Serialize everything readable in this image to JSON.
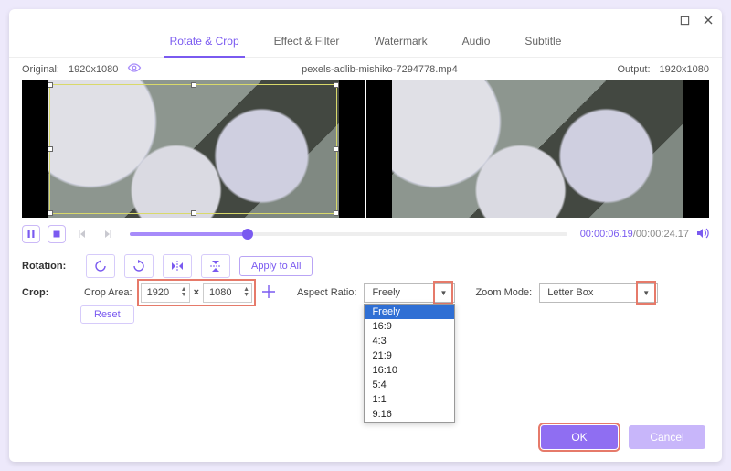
{
  "tabs": {
    "rotate_crop": "Rotate & Crop",
    "effect_filter": "Effect & Filter",
    "watermark": "Watermark",
    "audio": "Audio",
    "subtitle": "Subtitle"
  },
  "infobar": {
    "original_label": "Original:",
    "original_res": "1920x1080",
    "filename": "pexels-adlib-mishiko-7294778.mp4",
    "output_label": "Output:",
    "output_res": "1920x1080"
  },
  "playback": {
    "current": "00:00:06.19",
    "duration": "00:00:24.17"
  },
  "rotation": {
    "label": "Rotation:",
    "apply_all": "Apply to All"
  },
  "crop": {
    "label": "Crop:",
    "area_label": "Crop Area:",
    "width": "1920",
    "height": "1080",
    "reset": "Reset",
    "aspect_label": "Aspect Ratio:",
    "aspect_value": "Freely",
    "aspect_options": [
      "Freely",
      "16:9",
      "4:3",
      "21:9",
      "16:10",
      "5:4",
      "1:1",
      "9:16"
    ],
    "zoom_label": "Zoom Mode:",
    "zoom_value": "Letter Box"
  },
  "footer": {
    "ok": "OK",
    "cancel": "Cancel"
  }
}
